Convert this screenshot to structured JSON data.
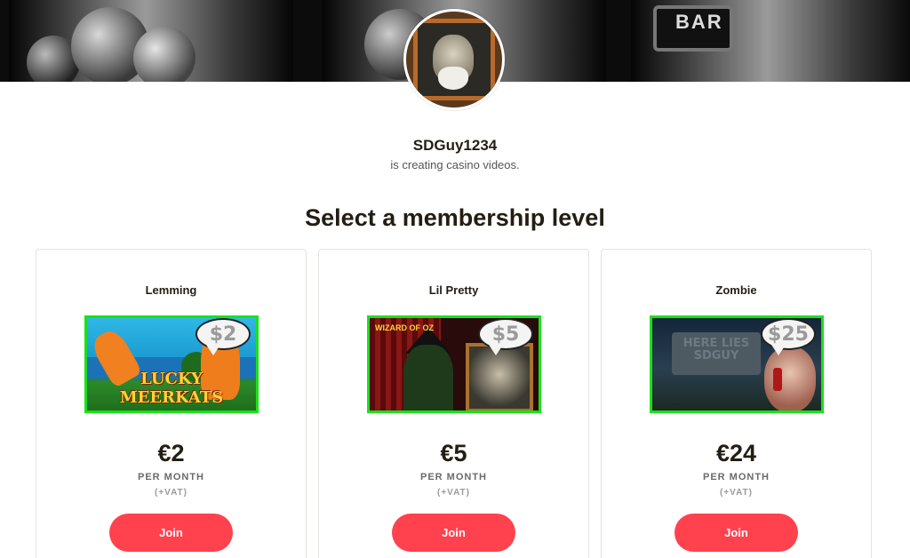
{
  "banner": {
    "alt_text": "BAR"
  },
  "creator": {
    "name": "SDGuy1234",
    "tagline": "is creating casino videos."
  },
  "section_title": "Select a membership level",
  "tiers": [
    {
      "name": "Lemming",
      "badge": "$2",
      "art_text": "LUCKY MEERKATS",
      "price": "€2",
      "period": "PER MONTH",
      "tax": "(+VAT)",
      "button": "Join"
    },
    {
      "name": "Lil Pretty",
      "badge": "$5",
      "art_text": "WIZARD OF OZ",
      "price": "€5",
      "period": "PER MONTH",
      "tax": "(+VAT)",
      "button": "Join"
    },
    {
      "name": "Zombie",
      "badge": "$25",
      "art_text": "HERE LIES SDGUY",
      "price": "€24",
      "period": "PER MONTH",
      "tax": "(+VAT)",
      "button": "Join"
    }
  ],
  "colors": {
    "accent": "#ff424d",
    "tier_border": "#1be11b",
    "text": "#241e12"
  }
}
